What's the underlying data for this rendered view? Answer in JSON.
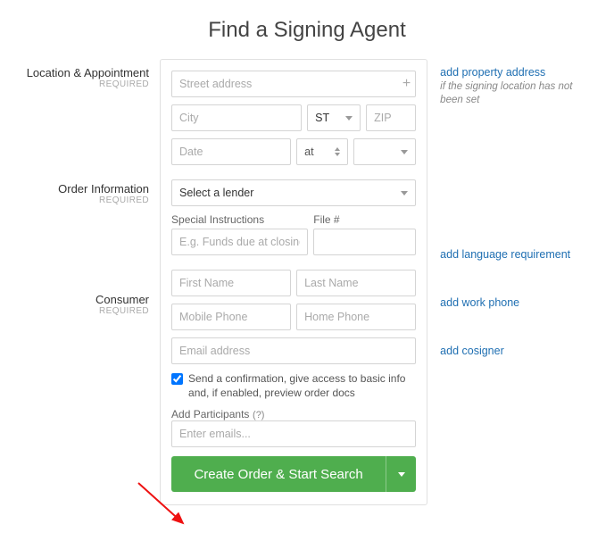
{
  "title": "Find a Signing Agent",
  "sections": {
    "location": {
      "label": "Location & Appointment",
      "required": "REQUIRED"
    },
    "order": {
      "label": "Order Information",
      "required": "REQUIRED"
    },
    "consumer": {
      "label": "Consumer",
      "required": "REQUIRED"
    }
  },
  "location": {
    "streetPlaceholder": "Street address",
    "cityPlaceholder": "City",
    "stateLabel": "ST",
    "zipPlaceholder": "ZIP",
    "datePlaceholder": "Date",
    "atLabel": "at"
  },
  "order": {
    "lenderPlaceholder": "Select a lender",
    "specialLabel": "Special Instructions",
    "specialPlaceholder": "E.g. Funds due at closing?",
    "fileLabel": "File #"
  },
  "consumer": {
    "firstPlaceholder": "First Name",
    "lastPlaceholder": "Last Name",
    "mobilePlaceholder": "Mobile Phone",
    "homePlaceholder": "Home Phone",
    "emailPlaceholder": "Email address",
    "confirmText": "Send a confirmation, give access to basic info and, if enabled, preview order docs",
    "participantsLabel": "Add Participants",
    "participantsHelp": "(?)",
    "participantsPlaceholder": "Enter emails..."
  },
  "side": {
    "addProperty": "add property address",
    "addPropertyHint": "if the signing location has not been set",
    "addLanguage": "add language requirement",
    "addWorkPhone": "add work phone",
    "addCosigner": "add cosigner"
  },
  "cta": "Create Order & Start Search"
}
